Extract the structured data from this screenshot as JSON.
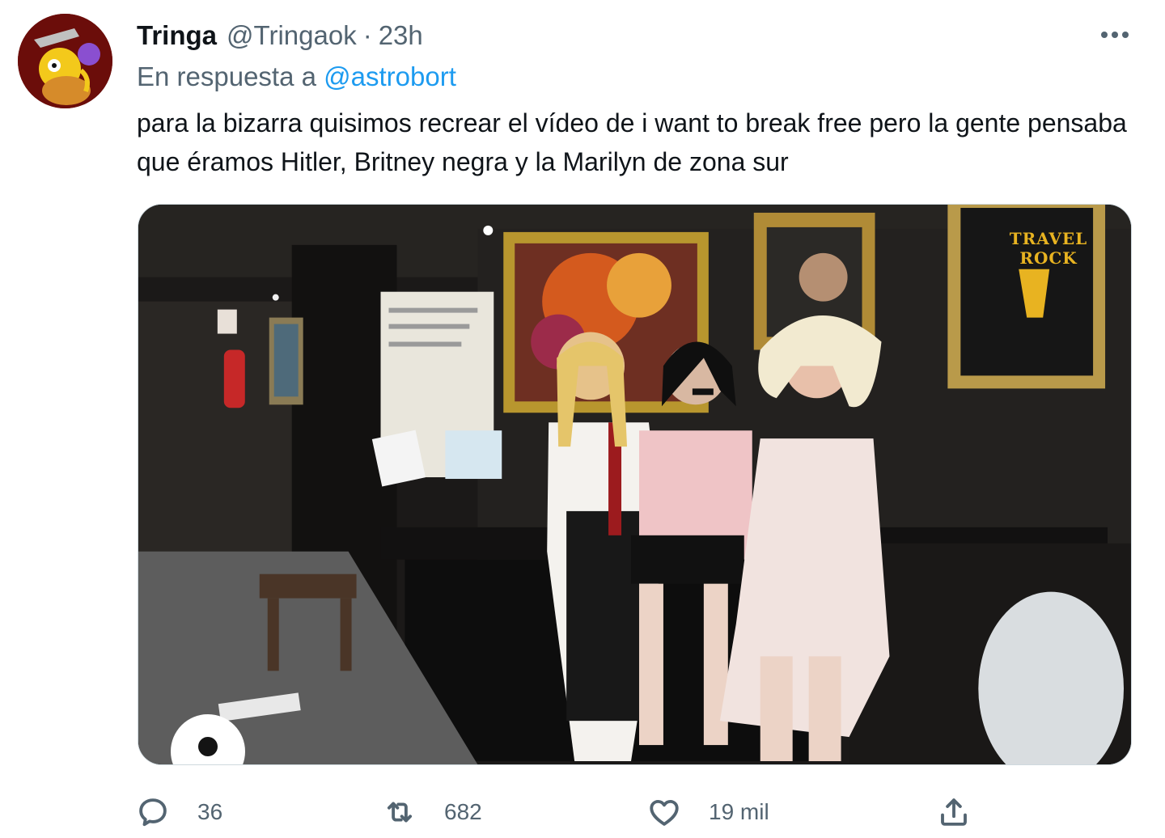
{
  "tweet": {
    "display_name": "Tringa",
    "handle": "@Tringaok",
    "separator": "·",
    "time": "23h",
    "reply_prefix": "En respuesta a",
    "reply_to": "@astrobort",
    "text": "para la bizarra quisimos recrear el vídeo de i want to break free pero la gente pensaba que éramos Hitler, Britney negra y la Marilyn de zona sur",
    "media_sign_text": "TRAVEL ROCK"
  },
  "actions": {
    "reply_count": "36",
    "retweet_count": "682",
    "like_count": "19 mil"
  },
  "icons": {
    "more": "more-horizontal-icon",
    "reply": "reply-icon",
    "retweet": "retweet-icon",
    "like": "heart-icon",
    "share": "share-icon"
  },
  "colors": {
    "text": "#0f1419",
    "secondary": "#536471",
    "link": "#1d9bf0"
  }
}
